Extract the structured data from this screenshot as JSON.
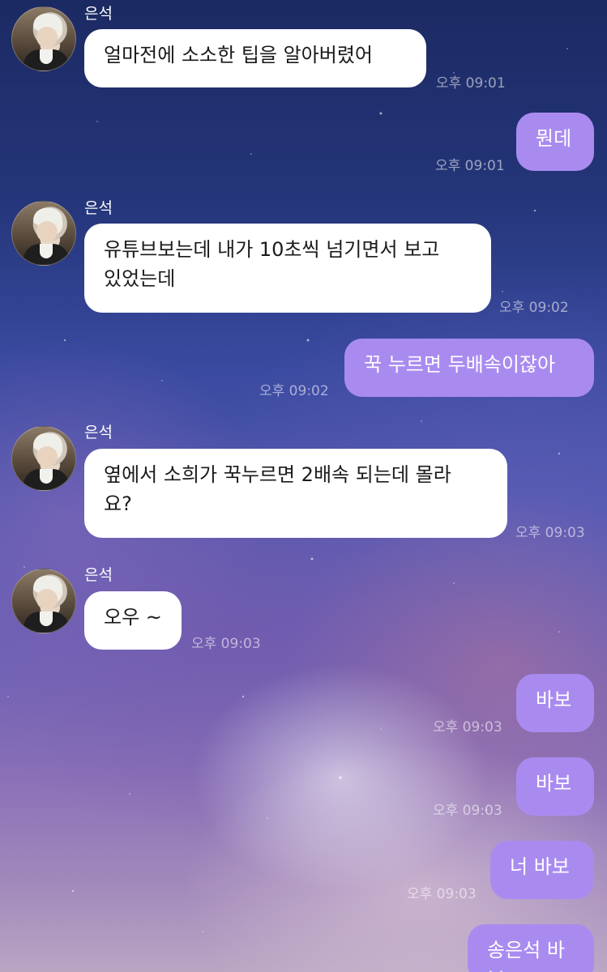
{
  "chat": {
    "contact_name": "은석",
    "messages": [
      {
        "side": "in",
        "text": "얼마전에 소소한 팁을 알아버렸어",
        "time": "오후 09:01"
      },
      {
        "side": "out",
        "text": "뭔데",
        "time": "오후 09:01"
      },
      {
        "side": "in",
        "text": "유튜브보는데 내가 10초씩 넘기면서 보고\n있었는데",
        "time": "오후 09:02"
      },
      {
        "side": "out",
        "text": "꾹 누르면 두배속이잖아",
        "time": "오후 09:02"
      },
      {
        "side": "in",
        "text": "옆에서 소희가 꾹누르면 2배속 되는데 몰라\n요?",
        "time": "오후 09:03"
      },
      {
        "side": "in",
        "text": "오우 ~",
        "time": "오후 09:03"
      },
      {
        "side": "out",
        "text": "바보",
        "time": "오후 09:03"
      },
      {
        "side": "out",
        "text": "바보",
        "time": "오후 09:03"
      },
      {
        "side": "out",
        "text": "너 바보",
        "time": "오후 09:03"
      },
      {
        "side": "out",
        "text": "송은석 바보",
        "time": ""
      }
    ]
  },
  "colors": {
    "incoming_bubble": "#ffffff",
    "outgoing_bubble": "#a98bf0",
    "timestamp": "rgba(255,255,255,0.55)"
  }
}
